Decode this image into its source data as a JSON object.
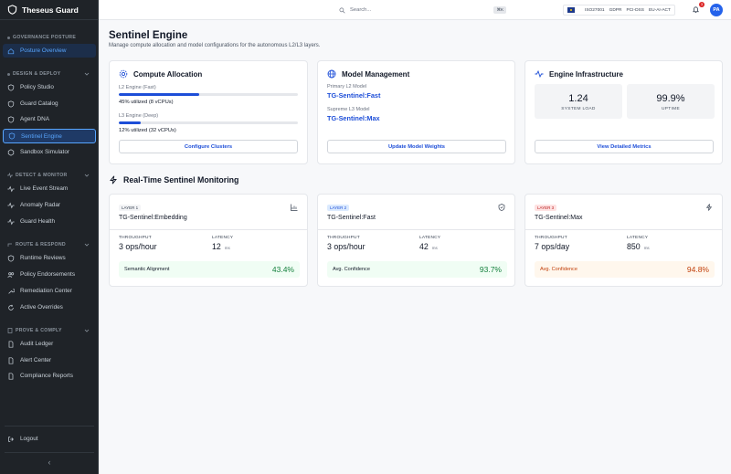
{
  "app": {
    "name": "Theseus Guard"
  },
  "sidebar": {
    "sections": [
      {
        "title": "GOVERNANCE POSTURE",
        "items": [
          {
            "label": "Posture Overview"
          }
        ]
      },
      {
        "title": "DESIGN & DEPLOY",
        "items": [
          {
            "label": "Policy Studio"
          },
          {
            "label": "Guard Catalog"
          },
          {
            "label": "Agent DNA"
          },
          {
            "label": "Sentinel Engine"
          },
          {
            "label": "Sandbox Simulator"
          }
        ]
      },
      {
        "title": "DETECT & MONITOR",
        "items": [
          {
            "label": "Live Event Stream"
          },
          {
            "label": "Anomaly Radar"
          },
          {
            "label": "Guard Health"
          }
        ]
      },
      {
        "title": "ROUTE & RESPOND",
        "items": [
          {
            "label": "Runtime Reviews"
          },
          {
            "label": "Policy Endorsements"
          },
          {
            "label": "Remediation Center"
          },
          {
            "label": "Active Overrides"
          }
        ]
      },
      {
        "title": "PROVE & COMPLY",
        "items": [
          {
            "label": "Audit Ledger"
          },
          {
            "label": "Alert Center"
          },
          {
            "label": "Compliance Reports"
          }
        ]
      }
    ],
    "logout": "Logout",
    "collapse": "‹"
  },
  "topbar": {
    "search_placeholder": "Search...",
    "search_shortcut": "⌘K",
    "compliance": [
      "ISO27001",
      "GDPR",
      "PCI-DSS",
      "EU-AI-ACT"
    ],
    "notifications": "3",
    "avatar": "PA"
  },
  "page": {
    "title": "Sentinel Engine",
    "subtitle": "Manage compute allocation and model configurations for the autonomous L2/L3 layers."
  },
  "compute": {
    "title": "Compute Allocation",
    "l2_label": "L2 Engine (Fast)",
    "l2_util": "45% utilized (8 vCPUs)",
    "l2_fill": 0.45,
    "l3_label": "L3 Engine (Deep)",
    "l3_util": "12% utilized (32 vCPUs)",
    "l3_fill": 0.12,
    "button": "Configure Clusters"
  },
  "models": {
    "title": "Model Management",
    "primary_label": "Primary L2 Model",
    "primary_value": "TG-Sentinel:Fast",
    "supreme_label": "Supreme L3 Model",
    "supreme_value": "TG-Sentinel:Max",
    "button": "Update Model Weights"
  },
  "infra": {
    "title": "Engine Infrastructure",
    "load_value": "1.24",
    "load_label": "SYSTEM LOAD",
    "uptime_value": "99.9%",
    "uptime_label": "UPTIME",
    "button": "View Detailed Metrics"
  },
  "monitoring": {
    "title": "Real-Time Sentinel Monitoring",
    "throughput_label": "THROUGHPUT",
    "latency_label": "LATENCY",
    "latency_unit": "ms",
    "layers": [
      {
        "tag": "LAYER 1",
        "name": "TG-Sentinel:Embedding",
        "throughput": "3 ops/hour",
        "latency": "12",
        "metric_label": "Semantic Alignment",
        "metric_value": "43.4%",
        "icon": "chart-icon"
      },
      {
        "tag": "LAYER 2",
        "name": "TG-Sentinel:Fast",
        "throughput": "3 ops/hour",
        "latency": "42",
        "metric_label": "Avg. Confidence",
        "metric_value": "93.7%",
        "icon": "shield-icon"
      },
      {
        "tag": "LAYER 3",
        "name": "TG-Sentinel:Max",
        "throughput": "7 ops/day",
        "latency": "850",
        "metric_label": "Avg. Confidence",
        "metric_value": "94.8%",
        "icon": "bolt-icon"
      }
    ]
  },
  "colors": {
    "accent": "#1d4ed8",
    "sidebar_bg": "#1f2328",
    "success": "#15803d",
    "warning": "#c2410c"
  }
}
